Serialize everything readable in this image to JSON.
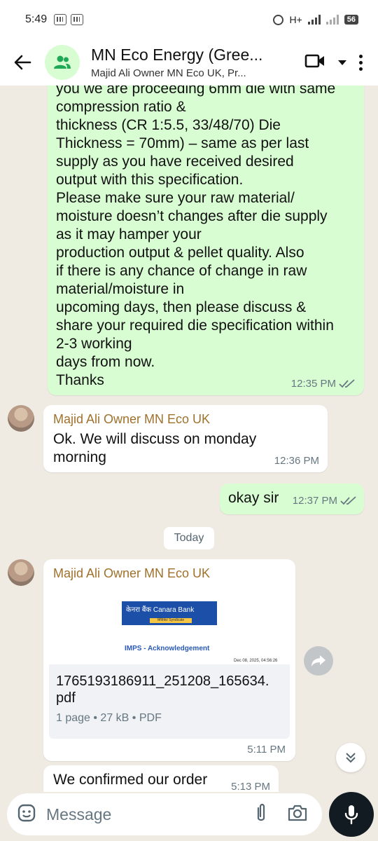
{
  "status_bar": {
    "time": "5:49",
    "network": "H+",
    "battery": "56"
  },
  "header": {
    "title": "MN Eco Energy (Gree...",
    "subtitle": "Majid Ali Owner MN Eco UK, Pr..."
  },
  "messages": {
    "m1": {
      "text": "you we are proceeding 6mm die with same\ncompression ratio &\nthickness (CR 1:5.5, 33/48/70) Die\nThickness = 70mm)  – same as per last\nsupply as you have received desired\noutput with this specification.\nPlease make sure your raw material/\nmoisture doesn’t changes after die supply\nas it may hamper your\nproduction output & pellet quality. Also\nif there is any chance of change in raw\nmaterial/moisture in\nupcoming days, then please discuss &\nshare your required die specification within\n2-3 working\ndays from now.\nThanks",
      "time": "12:35 PM"
    },
    "m2": {
      "sender": "Majid Ali Owner MN Eco UK",
      "text": "Ok. We will discuss on monday\nmorning",
      "time": "12:36 PM"
    },
    "m3": {
      "text": "okay sir",
      "time": "12:37 PM"
    },
    "date_chip": "Today",
    "m4": {
      "sender": "Majid Ali Owner MN Eco UK",
      "preview": {
        "bank": "केनरा बैंक Canara Bank",
        "bank_sub": "सिंडिकेट Syndicate",
        "heading": "IMPS - Acknowledgement",
        "date": "Dec 08, 2025, 04:56:26"
      },
      "file_name": "1765193186911_251208_165634.\npdf",
      "file_meta": "1 page • 27 kB • PDF",
      "time": "5:11 PM"
    },
    "m5": {
      "text": "We confirmed our order",
      "time": "5:13 PM"
    }
  },
  "input": {
    "placeholder": "Message"
  }
}
